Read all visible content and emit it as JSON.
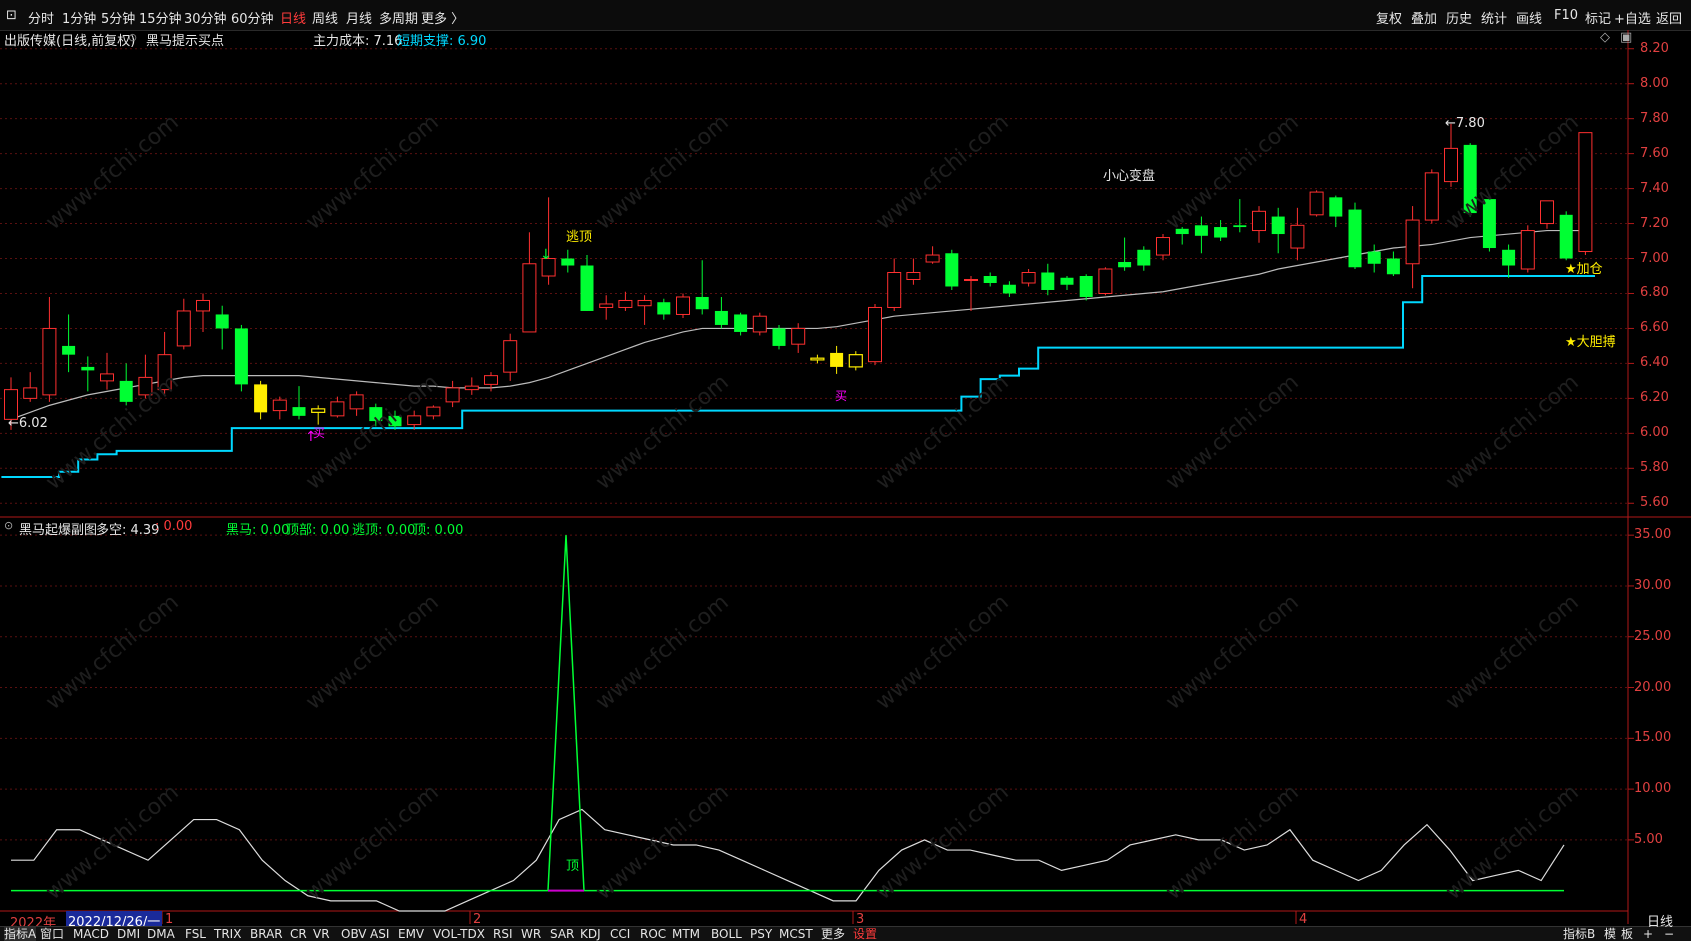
{
  "toolbar": {
    "periods": [
      "分时",
      "1分钟",
      "5分钟",
      "15分钟",
      "30分钟",
      "60分钟",
      "日线",
      "周线",
      "月线",
      "多周期",
      "更多 〉"
    ],
    "active_period": "日线",
    "right": [
      "复权",
      "叠加",
      "历史",
      "统计",
      "画线",
      "F10",
      "标记",
      "+自选",
      "返回"
    ]
  },
  "main_panel": {
    "title": "出版传媒(日线,前复权)",
    "indicator": "黑马提示买点",
    "cost_label": "主力成本: 7.16",
    "support_label": "短期支撑: 6.90",
    "y_ticks": [
      "8.20",
      "8.00",
      "7.80",
      "7.60",
      "7.40",
      "7.20",
      "7.00",
      "6.80",
      "6.60",
      "6.40",
      "6.20",
      "6.00",
      "5.80",
      "5.60"
    ],
    "annotations": {
      "high": "7.80",
      "low": "6.02",
      "escape_top": "逃顶",
      "caution": "小心变盘",
      "buy1": "买",
      "buy2": "买",
      "add": "★加仓",
      "bold_buy": "★大胆搏"
    }
  },
  "sub_panel": {
    "title": "黑马起爆副图",
    "duokong": "多空: 4.39",
    "duokong_val": ": 0.00",
    "heima": "黑马: 0.00",
    "dingbu": "顶部: 0.00",
    "taoding": "逃顶: 0.00",
    "ding": "顶: 0.00",
    "y_ticks": [
      "35.00",
      "30.00",
      "25.00",
      "20.00",
      "15.00",
      "10.00",
      "5.00"
    ],
    "peak_label": "顶"
  },
  "date_axis": {
    "year": "2022年",
    "cursor_date": "2022/12/26/一",
    "months": [
      "1",
      "2",
      "3",
      "4"
    ]
  },
  "bottom_tabs": [
    "指标A",
    "窗口",
    "MACD",
    "DMI",
    "DMA",
    "FSL",
    "TRIX",
    "BRAR",
    "CR",
    "VR",
    "OBV",
    "ASI",
    "EMV",
    "VOL-TDX",
    "RSI",
    "WR",
    "SAR",
    "KDJ",
    "CCI",
    "ROC",
    "MTM",
    "BOLL",
    "PSY",
    "MCST",
    "更多",
    "设置"
  ],
  "bottom_right": [
    "指标B",
    "模",
    "板",
    "+",
    "−"
  ],
  "period_label": "日线",
  "watermark": "www.cfchi.com",
  "colors": {
    "up": "#ff3030",
    "down": "#00ff33",
    "yellow": "#ffee00",
    "support": "#00d8ff",
    "ma": "#bbbbbb",
    "axis": "#e04040",
    "grid": "#5a1010"
  },
  "chart_data": {
    "type": "candlestick",
    "y_range": [
      5.55,
      8.25
    ],
    "candles": [
      [
        6.08,
        6.25,
        6.32,
        6.02
      ],
      [
        6.2,
        6.26,
        6.35,
        6.18
      ],
      [
        6.22,
        6.6,
        6.78,
        6.18
      ],
      [
        6.5,
        6.45,
        6.68,
        6.35
      ],
      [
        6.38,
        6.36,
        6.44,
        6.24
      ],
      [
        6.3,
        6.34,
        6.46,
        6.25
      ],
      [
        6.3,
        6.18,
        6.4,
        6.16
      ],
      [
        6.22,
        6.32,
        6.45,
        6.2
      ],
      [
        6.25,
        6.45,
        6.58,
        6.22
      ],
      [
        6.5,
        6.7,
        6.77,
        6.48
      ],
      [
        6.7,
        6.76,
        6.8,
        6.58
      ],
      [
        6.68,
        6.6,
        6.73,
        6.48
      ],
      [
        6.6,
        6.28,
        6.62,
        6.24
      ],
      [
        6.28,
        6.12,
        6.3,
        6.08
      ],
      [
        6.13,
        6.19,
        6.21,
        6.08
      ],
      [
        6.15,
        6.1,
        6.27,
        6.08
      ],
      [
        6.12,
        6.14,
        6.16,
        6.05
      ],
      [
        6.1,
        6.18,
        6.21,
        6.09
      ],
      [
        6.14,
        6.22,
        6.24,
        6.1
      ],
      [
        6.15,
        6.07,
        6.17,
        6.04
      ],
      [
        6.1,
        6.04,
        6.13,
        6.02
      ],
      [
        6.05,
        6.1,
        6.13,
        6.02
      ],
      [
        6.1,
        6.15,
        6.16,
        6.08
      ],
      [
        6.18,
        6.26,
        6.3,
        6.15
      ],
      [
        6.25,
        6.27,
        6.32,
        6.22
      ],
      [
        6.28,
        6.33,
        6.35,
        6.24
      ],
      [
        6.35,
        6.53,
        6.57,
        6.3
      ],
      [
        6.58,
        6.97,
        7.15,
        6.58
      ],
      [
        6.9,
        7.0,
        7.35,
        6.85
      ],
      [
        7.0,
        6.96,
        7.05,
        6.92
      ],
      [
        6.96,
        6.7,
        7.02,
        6.7
      ],
      [
        6.72,
        6.74,
        6.79,
        6.65
      ],
      [
        6.72,
        6.76,
        6.81,
        6.7
      ],
      [
        6.73,
        6.76,
        6.79,
        6.62
      ],
      [
        6.75,
        6.68,
        6.77,
        6.65
      ],
      [
        6.68,
        6.78,
        6.8,
        6.66
      ],
      [
        6.78,
        6.71,
        6.99,
        6.68
      ],
      [
        6.7,
        6.62,
        6.78,
        6.6
      ],
      [
        6.68,
        6.58,
        6.69,
        6.56
      ],
      [
        6.58,
        6.67,
        6.69,
        6.56
      ],
      [
        6.6,
        6.5,
        6.62,
        6.48
      ],
      [
        6.51,
        6.6,
        6.63,
        6.46
      ],
      [
        6.42,
        6.43,
        6.45,
        6.4
      ],
      [
        6.46,
        6.38,
        6.5,
        6.34
      ],
      [
        6.38,
        6.45,
        6.47,
        6.36
      ],
      [
        6.41,
        6.72,
        6.74,
        6.39
      ],
      [
        6.72,
        6.92,
        7.0,
        6.7
      ],
      [
        6.88,
        6.92,
        7.0,
        6.85
      ],
      [
        6.98,
        7.02,
        7.07,
        6.97
      ],
      [
        7.03,
        6.84,
        7.05,
        6.82
      ],
      [
        6.88,
        6.88,
        6.9,
        6.7
      ],
      [
        6.9,
        6.86,
        6.92,
        6.84
      ],
      [
        6.85,
        6.8,
        6.87,
        6.78
      ],
      [
        6.86,
        6.92,
        6.94,
        6.84
      ],
      [
        6.92,
        6.82,
        6.97,
        6.79
      ],
      [
        6.89,
        6.85,
        6.9,
        6.82
      ],
      [
        6.9,
        6.78,
        6.91,
        6.76
      ],
      [
        6.8,
        6.94,
        6.95,
        6.79
      ],
      [
        6.98,
        6.95,
        7.12,
        6.93
      ],
      [
        7.05,
        6.96,
        7.07,
        6.93
      ],
      [
        7.02,
        7.12,
        7.14,
        6.99
      ],
      [
        7.17,
        7.14,
        7.18,
        7.08
      ],
      [
        7.19,
        7.13,
        7.24,
        7.03
      ],
      [
        7.18,
        7.12,
        7.22,
        7.1
      ],
      [
        7.19,
        7.18,
        7.34,
        7.15
      ],
      [
        7.16,
        7.27,
        7.3,
        7.09
      ],
      [
        7.24,
        7.14,
        7.29,
        7.03
      ],
      [
        7.06,
        7.19,
        7.29,
        6.99
      ],
      [
        7.25,
        7.38,
        7.39,
        7.24
      ],
      [
        7.35,
        7.24,
        7.36,
        7.18
      ],
      [
        7.28,
        6.95,
        7.32,
        6.94
      ],
      [
        7.04,
        6.97,
        7.08,
        6.92
      ],
      [
        7.0,
        6.91,
        7.04,
        6.9
      ],
      [
        6.97,
        7.22,
        7.3,
        6.83
      ],
      [
        7.22,
        7.49,
        7.51,
        7.2
      ],
      [
        7.44,
        7.63,
        7.77,
        7.41
      ],
      [
        7.65,
        7.26,
        7.66,
        7.24
      ],
      [
        7.34,
        7.06,
        7.36,
        7.04
      ],
      [
        7.05,
        6.96,
        7.08,
        6.89
      ],
      [
        6.94,
        7.16,
        7.19,
        6.92
      ],
      [
        7.2,
        7.33,
        7.33,
        7.17
      ],
      [
        7.25,
        7.0,
        7.27,
        6.99
      ],
      [
        7.04,
        7.72,
        7.72,
        7.02
      ]
    ],
    "yellow_candles": [
      13,
      16,
      42,
      43,
      44
    ],
    "ma": [
      6.08,
      6.12,
      6.16,
      6.19,
      6.22,
      6.24,
      6.26,
      6.28,
      6.3,
      6.32,
      6.33,
      6.33,
      6.33,
      6.33,
      6.33,
      6.33,
      6.32,
      6.31,
      6.3,
      6.29,
      6.28,
      6.27,
      6.27,
      6.26,
      6.26,
      6.26,
      6.27,
      6.29,
      6.32,
      6.36,
      6.4,
      6.44,
      6.48,
      6.52,
      6.55,
      6.58,
      6.6,
      6.6,
      6.6,
      6.6,
      6.6,
      6.6,
      6.6,
      6.61,
      6.63,
      6.65,
      6.67,
      6.68,
      6.69,
      6.7,
      6.71,
      6.72,
      6.73,
      6.74,
      6.75,
      6.76,
      6.77,
      6.78,
      6.79,
      6.8,
      6.81,
      6.83,
      6.85,
      6.87,
      6.89,
      6.91,
      6.94,
      6.96,
      6.98,
      7.0,
      7.02,
      7.04,
      7.06,
      7.07,
      7.08,
      7.1,
      7.12,
      7.13,
      7.14,
      7.15,
      7.16,
      7.16,
      7.16
    ],
    "support": [
      5.75,
      5.75,
      5.75,
      5.78,
      5.85,
      5.88,
      5.9,
      5.9,
      5.9,
      5.9,
      5.9,
      5.9,
      6.03,
      6.03,
      6.03,
      6.03,
      6.03,
      6.03,
      6.03,
      6.03,
      6.03,
      6.03,
      6.03,
      6.03,
      6.13,
      6.13,
      6.13,
      6.13,
      6.13,
      6.13,
      6.13,
      6.13,
      6.13,
      6.13,
      6.13,
      6.13,
      6.13,
      6.13,
      6.13,
      6.13,
      6.13,
      6.13,
      6.13,
      6.13,
      6.13,
      6.13,
      6.13,
      6.13,
      6.13,
      6.13,
      6.21,
      6.31,
      6.33,
      6.37,
      6.49,
      6.49,
      6.49,
      6.49,
      6.49,
      6.49,
      6.49,
      6.49,
      6.49,
      6.49,
      6.49,
      6.49,
      6.49,
      6.49,
      6.49,
      6.49,
      6.49,
      6.49,
      6.49,
      6.75,
      6.9,
      6.9,
      6.9,
      6.9,
      6.9,
      6.9,
      6.9,
      6.9,
      6.9
    ],
    "sub_y_range": [
      -2,
      36
    ],
    "sub_white": [
      3,
      3,
      6,
      6,
      5,
      4,
      3,
      5,
      7,
      7,
      6,
      3,
      1,
      -0.5,
      -1,
      -1,
      -1,
      -2,
      -2,
      -2,
      -1,
      0,
      1,
      3,
      7,
      8,
      6,
      5.5,
      5,
      4.5,
      4.5,
      4,
      3,
      2,
      1,
      0,
      -1,
      -1,
      2,
      4,
      5,
      4,
      4,
      3.5,
      3,
      3,
      2,
      2.5,
      3,
      4.5,
      5,
      5.5,
      5,
      5,
      4,
      4.5,
      6,
      3,
      2,
      1,
      2,
      4.5,
      6.5,
      4,
      1,
      1.5,
      2,
      1,
      4.5
    ],
    "sub_green_base": 0,
    "sub_spike_peak": 35
  }
}
